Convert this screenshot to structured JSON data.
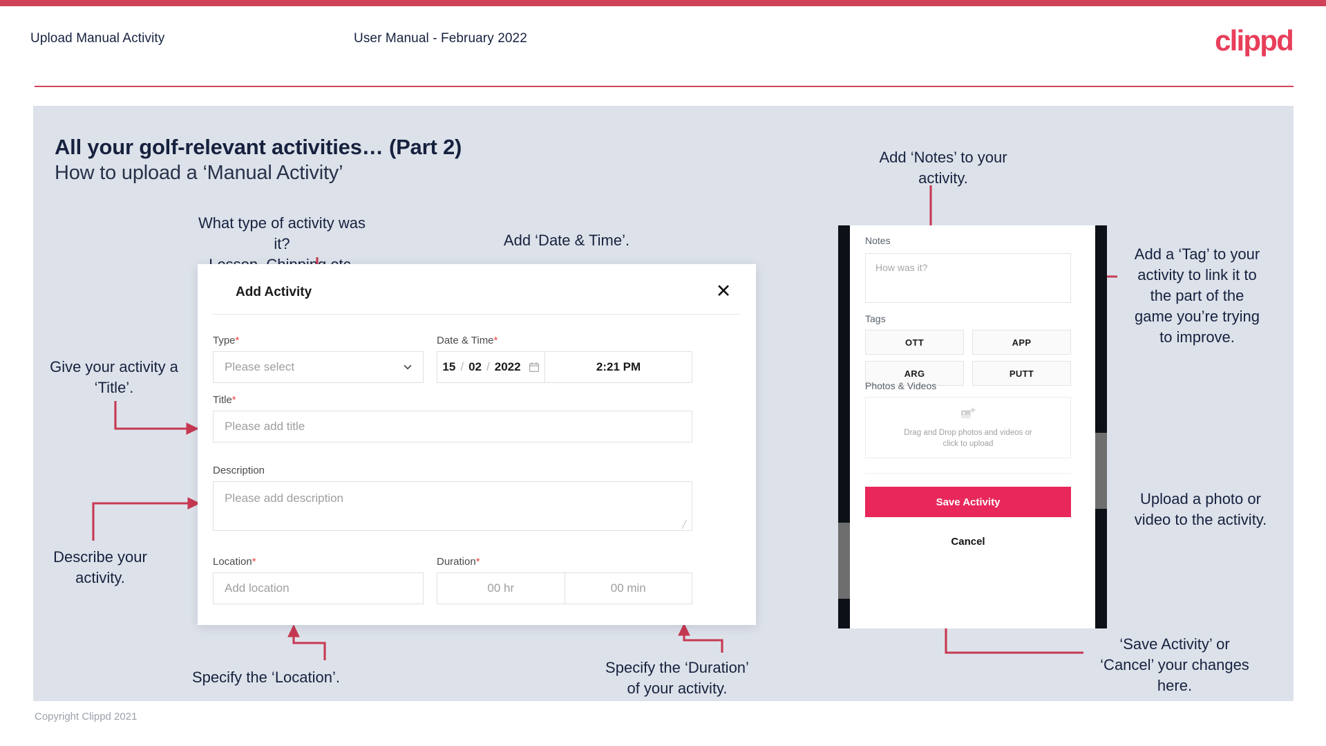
{
  "header": {
    "left_title": "Upload Manual Activity",
    "center_title": "User Manual - February 2022",
    "logo": "clippd"
  },
  "slide": {
    "title": "All your golf-relevant activities… (Part 2)",
    "subtitle": "How to upload a ‘Manual Activity’",
    "footer": "Copyright Clippd 2021"
  },
  "annotations": {
    "type": "What type of activity was it?\nLesson, Chipping etc.",
    "datetime": "Add ‘Date & Time’.",
    "title": "Give your activity a\n‘Title’.",
    "description": "Describe your\nactivity.",
    "location": "Specify the ‘Location’.",
    "duration": "Specify the ‘Duration’\nof your activity.",
    "notes": "Add ‘Notes’ to your\nactivity.",
    "tags": "Add a ‘Tag’ to your\nactivity to link it to\nthe part of the\ngame you’re trying\nto improve.",
    "photos": "Upload a photo or\nvideo to the activity.",
    "save_cancel": "‘Save Activity’ or\n‘Cancel’ your changes\nhere."
  },
  "dialog": {
    "title": "Add Activity",
    "close_icon": "close-icon",
    "fields": {
      "type": {
        "label": "Type",
        "required": "*",
        "placeholder": "Please select",
        "icon": "chevron-down-icon"
      },
      "datetime": {
        "label": "Date & Time",
        "required": "*",
        "day": "15",
        "month": "02",
        "year": "2022",
        "sep": "/",
        "time": "2:21 PM",
        "icon": "calendar-icon"
      },
      "title": {
        "label": "Title",
        "required": "*",
        "placeholder": "Please add title"
      },
      "description": {
        "label": "Description",
        "required": "",
        "placeholder": "Please add description"
      },
      "location": {
        "label": "Location",
        "required": "*",
        "placeholder": "Add location"
      },
      "duration": {
        "label": "Duration",
        "required": "*",
        "hours_placeholder": "00 hr",
        "minutes_placeholder": "00 min"
      }
    }
  },
  "phone": {
    "notes": {
      "label": "Notes",
      "placeholder": "How was it?"
    },
    "tags": {
      "label": "Tags",
      "items": [
        "OTT",
        "APP",
        "ARG",
        "PUTT"
      ]
    },
    "photos": {
      "label": "Photos & Videos",
      "icon": "add-image-icon",
      "drop_line1": "Drag and Drop photos and videos or",
      "drop_line2": "click to upload"
    },
    "save_label": "Save Activity",
    "cancel_label": "Cancel"
  },
  "colors": {
    "accent_pink": "#e8275a",
    "accent_rule": "#cf4257",
    "slide_bg": "#dde2ea",
    "ink": "#16213e",
    "arrow": "#c73953"
  }
}
